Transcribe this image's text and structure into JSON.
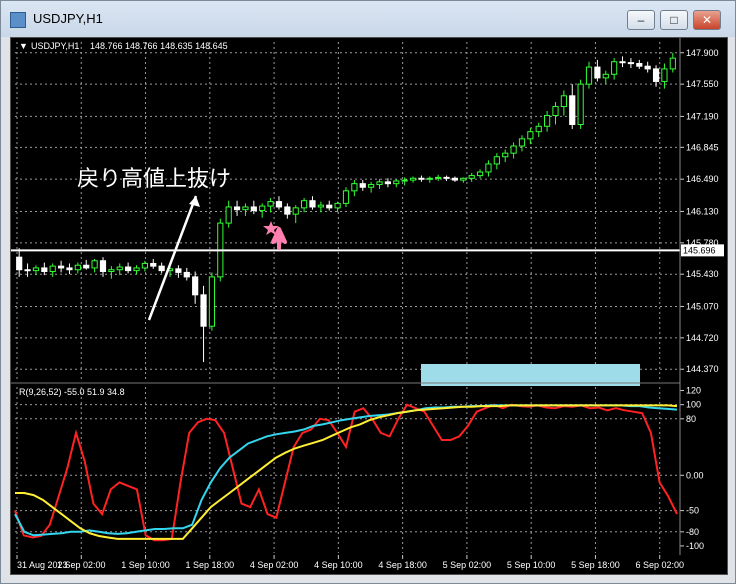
{
  "window": {
    "title": "USDJPY,H1",
    "buttons": [
      "minimize",
      "maximize",
      "close"
    ]
  },
  "chart_data": [
    {
      "type": "candlestick",
      "symbol_label": "USDJPY,H1",
      "ohlc_label": "148.766 148.766 148.635 148.645",
      "ylim": [
        144.25,
        148.02
      ],
      "y_ticks": [
        "147.900",
        "147.550",
        "147.190",
        "146.845",
        "146.490",
        "146.130",
        "145.780",
        "145.430",
        "145.070",
        "144.720",
        "144.370"
      ],
      "current_price": "145.696",
      "current_price_value": 145.696,
      "annotation": "戻り高値上抜け",
      "colors": {
        "bull": "#33ff33",
        "bear": "#ffffff",
        "background": "#000000",
        "grid": "#cccccc",
        "price_line": "#ffffff",
        "annotation": "#ffffff",
        "marker": "#ff7fb0",
        "highlight": "#9fdcea"
      },
      "markers": [
        "star-icon",
        "up-arrow-icon"
      ],
      "candles": [
        [
          145.62,
          145.72,
          145.4,
          145.48
        ],
        [
          145.48,
          145.55,
          145.4,
          145.47
        ],
        [
          145.47,
          145.53,
          145.42,
          145.5
        ],
        [
          145.5,
          145.56,
          145.42,
          145.46
        ],
        [
          145.46,
          145.55,
          145.4,
          145.52
        ],
        [
          145.52,
          145.58,
          145.45,
          145.5
        ],
        [
          145.5,
          145.55,
          145.43,
          145.48
        ],
        [
          145.48,
          145.56,
          145.44,
          145.53
        ],
        [
          145.53,
          145.59,
          145.48,
          145.5
        ],
        [
          145.5,
          145.6,
          145.45,
          145.58
        ],
        [
          145.58,
          145.62,
          145.4,
          145.46
        ],
        [
          145.46,
          145.52,
          145.38,
          145.48
        ],
        [
          145.48,
          145.55,
          145.42,
          145.51
        ],
        [
          145.51,
          145.56,
          145.44,
          145.47
        ],
        [
          145.47,
          145.53,
          145.43,
          145.5
        ],
        [
          145.5,
          145.58,
          145.46,
          145.55
        ],
        [
          145.55,
          145.6,
          145.49,
          145.52
        ],
        [
          145.52,
          145.56,
          145.44,
          145.47
        ],
        [
          145.47,
          145.52,
          145.4,
          145.49
        ],
        [
          145.49,
          145.53,
          145.39,
          145.45
        ],
        [
          145.45,
          145.5,
          145.36,
          145.4
        ],
        [
          145.4,
          145.46,
          145.1,
          145.2
        ],
        [
          145.2,
          145.3,
          144.45,
          144.85
        ],
        [
          144.85,
          145.45,
          144.8,
          145.4
        ],
        [
          145.4,
          146.05,
          145.35,
          146.0
        ],
        [
          146.0,
          146.25,
          145.95,
          146.18
        ],
        [
          146.18,
          146.25,
          146.08,
          146.15
        ],
        [
          146.15,
          146.22,
          146.08,
          146.18
        ],
        [
          146.18,
          146.25,
          146.1,
          146.14
        ],
        [
          146.14,
          146.22,
          146.06,
          146.19
        ],
        [
          146.19,
          146.28,
          146.12,
          146.24
        ],
        [
          146.24,
          146.3,
          146.15,
          146.18
        ],
        [
          146.18,
          146.22,
          146.05,
          146.1
        ],
        [
          146.1,
          146.2,
          146.0,
          146.17
        ],
        [
          146.17,
          146.28,
          146.12,
          146.25
        ],
        [
          146.25,
          146.3,
          146.15,
          146.18
        ],
        [
          146.18,
          146.24,
          146.12,
          146.2
        ],
        [
          146.2,
          146.25,
          146.14,
          146.17
        ],
        [
          146.17,
          146.24,
          146.12,
          146.22
        ],
        [
          146.22,
          146.4,
          146.18,
          146.36
        ],
        [
          146.36,
          146.48,
          146.3,
          146.44
        ],
        [
          146.44,
          146.48,
          146.36,
          146.4
        ],
        [
          146.4,
          146.46,
          146.34,
          146.43
        ],
        [
          146.43,
          146.49,
          146.38,
          146.46
        ],
        [
          146.46,
          146.5,
          146.4,
          146.44
        ],
        [
          146.44,
          146.49,
          146.4,
          146.47
        ],
        [
          146.47,
          146.51,
          146.42,
          146.48
        ],
        [
          146.48,
          146.52,
          146.45,
          146.5
        ],
        [
          146.5,
          146.53,
          146.46,
          146.49
        ],
        [
          146.49,
          146.52,
          146.45,
          146.5
        ],
        [
          146.5,
          146.54,
          146.47,
          146.51
        ],
        [
          146.51,
          146.53,
          146.47,
          146.5
        ],
        [
          146.5,
          146.52,
          146.46,
          146.48
        ],
        [
          146.48,
          146.51,
          146.45,
          146.5
        ],
        [
          146.5,
          146.56,
          146.46,
          146.53
        ],
        [
          146.53,
          146.6,
          146.5,
          146.57
        ],
        [
          146.57,
          146.7,
          146.52,
          146.66
        ],
        [
          146.66,
          146.78,
          146.6,
          146.74
        ],
        [
          146.74,
          146.82,
          146.68,
          146.78
        ],
        [
          146.78,
          146.9,
          146.72,
          146.86
        ],
        [
          146.86,
          146.98,
          146.8,
          146.94
        ],
        [
          146.94,
          147.06,
          146.88,
          147.02
        ],
        [
          147.02,
          147.12,
          146.96,
          147.08
        ],
        [
          147.08,
          147.25,
          147.02,
          147.2
        ],
        [
          147.2,
          147.35,
          147.1,
          147.3
        ],
        [
          147.3,
          147.48,
          147.2,
          147.42
        ],
        [
          147.42,
          147.55,
          147.05,
          147.1
        ],
        [
          147.1,
          147.6,
          147.05,
          147.55
        ],
        [
          147.55,
          147.8,
          147.5,
          147.74
        ],
        [
          147.74,
          147.82,
          147.58,
          147.62
        ],
        [
          147.62,
          147.7,
          147.55,
          147.66
        ],
        [
          147.66,
          147.84,
          147.6,
          147.8
        ],
        [
          147.8,
          147.86,
          147.74,
          147.79
        ],
        [
          147.79,
          147.84,
          147.73,
          147.78
        ],
        [
          147.78,
          147.82,
          147.72,
          147.75
        ],
        [
          147.75,
          147.8,
          147.68,
          147.72
        ],
        [
          147.72,
          147.76,
          147.52,
          147.58
        ],
        [
          147.58,
          147.78,
          147.5,
          147.72
        ],
        [
          147.72,
          147.9,
          147.68,
          147.84
        ]
      ]
    },
    {
      "type": "line",
      "indicator_label": "R(9,26,52) -55.0 51.9 34.8",
      "ylim": [
        -110,
        125
      ],
      "y_ticks": [
        "120",
        "100",
        "80",
        "0.00",
        "-50",
        "-80",
        "-100"
      ],
      "x_tick_labels": [
        "31 Aug 2023",
        "1 Sep 02:00",
        "1 Sep 10:00",
        "1 Sep 18:00",
        "4 Sep 02:00",
        "4 Sep 10:00",
        "4 Sep 18:00",
        "5 Sep 02:00",
        "5 Sep 10:00",
        "5 Sep 18:00",
        "6 Sep 02:00"
      ],
      "highlight_band": {
        "from_bar": 56,
        "to_bar": 73
      },
      "series": [
        {
          "color": "#ff2222",
          "values": [
            -50,
            -85,
            -88,
            -86,
            -70,
            -30,
            10,
            60,
            20,
            -40,
            -55,
            -20,
            -10,
            -15,
            -20,
            -85,
            -92,
            -92,
            -90,
            -10,
            60,
            75,
            80,
            78,
            60,
            10,
            -40,
            -45,
            -20,
            -55,
            -60,
            -10,
            40,
            60,
            65,
            80,
            78,
            60,
            40,
            90,
            95,
            80,
            60,
            55,
            80,
            100,
            95,
            90,
            70,
            50,
            50,
            55,
            70,
            90,
            95,
            100,
            95,
            100,
            98,
            97,
            99,
            96,
            95,
            98,
            97,
            99,
            95,
            96,
            92,
            95,
            92,
            90,
            88,
            60,
            -10,
            -30,
            -55
          ]
        },
        {
          "color": "#33d6ee",
          "values": [
            -55,
            -80,
            -85,
            -84,
            -83,
            -82,
            -80,
            -80,
            -78,
            -80,
            -82,
            -83,
            -82,
            -80,
            -78,
            -76,
            -76,
            -75,
            -75,
            -70,
            -35,
            -10,
            10,
            25,
            35,
            45,
            50,
            55,
            58,
            60,
            62,
            65,
            70,
            72,
            75,
            78,
            80,
            82,
            84,
            85,
            86,
            88,
            90,
            92,
            95,
            96,
            96,
            97,
            97,
            98,
            98,
            99,
            99,
            99,
            99,
            99,
            99,
            99,
            99,
            99,
            99,
            99,
            99,
            99,
            99,
            99,
            98,
            98,
            96,
            95,
            94,
            93
          ]
        },
        {
          "color": "#ffee33",
          "values": [
            -25,
            -25,
            -28,
            -35,
            -45,
            -55,
            -65,
            -75,
            -82,
            -86,
            -88,
            -90,
            -90,
            -90,
            -90,
            -90,
            -90,
            -90,
            -90,
            -75,
            -60,
            -45,
            -35,
            -25,
            -15,
            -5,
            5,
            15,
            25,
            32,
            38,
            42,
            46,
            50,
            56,
            62,
            68,
            72,
            78,
            82,
            85,
            88,
            90,
            92,
            93,
            94,
            95,
            96,
            97,
            97,
            98,
            98,
            98,
            99,
            99,
            99,
            99,
            99,
            99,
            99,
            99,
            99,
            99,
            99,
            99,
            99,
            99,
            99,
            99,
            99,
            99,
            98
          ]
        }
      ]
    }
  ]
}
